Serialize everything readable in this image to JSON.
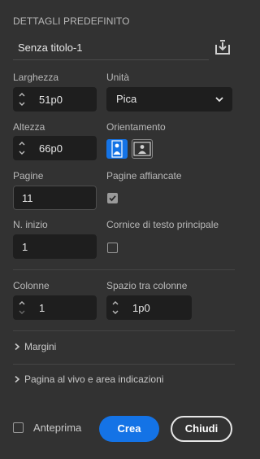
{
  "section_title": "DETTAGLI PREDEFINITO",
  "preset_name": "Senza titolo-1",
  "icons": {
    "save_preset": "save-preset-icon",
    "portrait": "portrait-orientation-icon",
    "landscape": "landscape-orientation-icon",
    "chevron_down": "chevron-down-icon",
    "chevron_right": "chevron-right-icon"
  },
  "width": {
    "label": "Larghezza",
    "value": "51p0"
  },
  "units": {
    "label": "Unità",
    "value": "Pica"
  },
  "height": {
    "label": "Altezza",
    "value": "66p0"
  },
  "orientation": {
    "label": "Orientamento",
    "selected": "portrait"
  },
  "pages": {
    "label": "Pagine",
    "value": "11"
  },
  "facing_pages": {
    "label": "Pagine affiancate",
    "checked": true
  },
  "start_number": {
    "label": "N. inizio",
    "value": "1"
  },
  "primary_text_frame": {
    "label": "Cornice di testo principale",
    "checked": false
  },
  "columns": {
    "label": "Colonne",
    "value": "1"
  },
  "gutter": {
    "label": "Spazio tra colonne",
    "value": "1p0"
  },
  "margins": {
    "label": "Margini"
  },
  "bleed_slug": {
    "label": "Pagina al vivo e area indicazioni"
  },
  "preview": {
    "label": "Anteprima",
    "checked": false
  },
  "create_button": "Crea",
  "close_button": "Chiudi",
  "colors": {
    "background": "#323232",
    "field": "#1e1e1e",
    "accent": "#1473e6"
  }
}
